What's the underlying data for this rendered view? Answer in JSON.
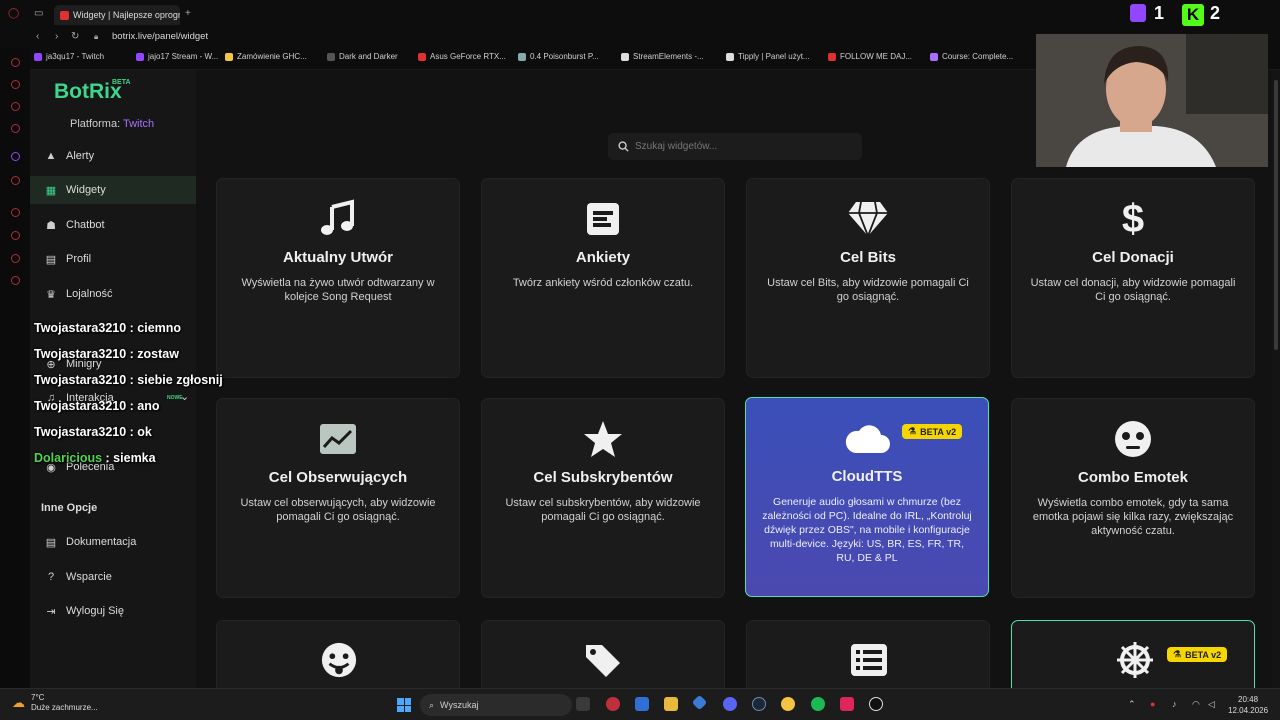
{
  "browser": {
    "tab_title": "Widgety | Najlepsze oprogr",
    "url": "botrix.live/panel/widget",
    "bookmarks": [
      "ja3qu17 - Twitch",
      "jajo17 Stream - W...",
      "Zamówienie GHC...",
      "Dark and Darker",
      "Asus GeForce RTX...",
      "0.4 Poisonburst P...",
      "StreamElements -...",
      "Tipply | Panel użyt...",
      "FOLLOW ME DAJ...",
      "Course: Complete..."
    ],
    "twitch_count": "1",
    "kick_count": "2"
  },
  "app": {
    "logo": "BotRix",
    "logo_badge": "BETA",
    "platform_label": "Platforma:",
    "platform_value": "Twitch",
    "nav": [
      {
        "label": "Alerty",
        "icon": "warning-icon"
      },
      {
        "label": "Widgety",
        "icon": "grid-icon",
        "active": true
      },
      {
        "label": "Chatbot",
        "icon": "robot-icon"
      },
      {
        "label": "Profil",
        "icon": "id-card-icon"
      },
      {
        "label": "Lojalność",
        "icon": "trophy-icon"
      },
      {
        "label": "Minigry",
        "icon": "gamepad-icon"
      },
      {
        "label": "Interakcja",
        "icon": "music-icon"
      },
      {
        "label": "Polecenia",
        "icon": "users-icon"
      }
    ],
    "new_badge": "NOWE",
    "other_section": "Inne Opcje",
    "other_nav": [
      {
        "label": "Dokumentacja",
        "icon": "document-icon"
      },
      {
        "label": "Wsparcie",
        "icon": "help-icon"
      },
      {
        "label": "Wyloguj Się",
        "icon": "logout-icon"
      }
    ],
    "search_placeholder": "Szukaj widgetów..."
  },
  "widgets": [
    {
      "title": "Aktualny Utwór",
      "desc": "Wyświetla na żywo utwór odtwarzany w kolejce Song Request",
      "icon": "music-note-icon"
    },
    {
      "title": "Ankiety",
      "desc": "Twórz ankiety wśród członków czatu.",
      "icon": "poll-icon"
    },
    {
      "title": "Cel Bits",
      "desc": "Ustaw cel Bits, aby widzowie pomagali Ci go osiągnąć.",
      "icon": "diamond-icon"
    },
    {
      "title": "Cel Donacji",
      "desc": "Ustaw cel donacji, aby widzowie pomagali Ci go osiągnąć.",
      "icon": "dollar-icon"
    },
    {
      "title": "Cel Obserwujących",
      "desc": "Ustaw cel obserwujących, aby widzowie pomagali Ci go osiągnąć.",
      "icon": "chart-icon"
    },
    {
      "title": "Cel Subskrybentów",
      "desc": "Ustaw cel subskrybentów, aby widzowie pomagali Ci go osiągnąć.",
      "icon": "star-icon"
    },
    {
      "title": "CloudTTS",
      "desc": "Generuje audio głosami w chmurze (bez zależności od PC). Idealne do IRL, „Kontroluj dźwięk przez OBS\", na mobile i konfiguracje multi-device. Języki: US, BR, ES, FR, TR, RU, DE & PL",
      "icon": "cloud-icon",
      "badge": "BETA v2"
    },
    {
      "title": "Combo Emotek",
      "desc": "Wyświetla combo emotek, gdy ta sama emotka pojawi się kilka razy, zwiększając aktywność czatu.",
      "icon": "emote-face-icon"
    }
  ],
  "partial_badge": "BETA v2",
  "chat": [
    {
      "user": "Twojastara3210",
      "msg": " : ciemno"
    },
    {
      "user": "Twojastara3210",
      "msg": " : zostaw"
    },
    {
      "user": "Twojastara3210",
      "msg": " : siebie zgłosnij"
    },
    {
      "user": "Twojastara3210",
      "msg": " : ano"
    },
    {
      "user": "Twojastara3210",
      "msg": " : ok"
    },
    {
      "user": "Dolaricious",
      "msg": " : siemka"
    }
  ],
  "taskbar": {
    "temp": "7°C",
    "weather": "Duże zachmurze...",
    "search": "Wyszukaj",
    "time": "20:48",
    "date": "12.04.2026"
  },
  "colors": {
    "brand": "#3dd68c",
    "twitch": "#a970ff",
    "beta": "#f5d600",
    "cloud_card": "#3f4db6"
  }
}
